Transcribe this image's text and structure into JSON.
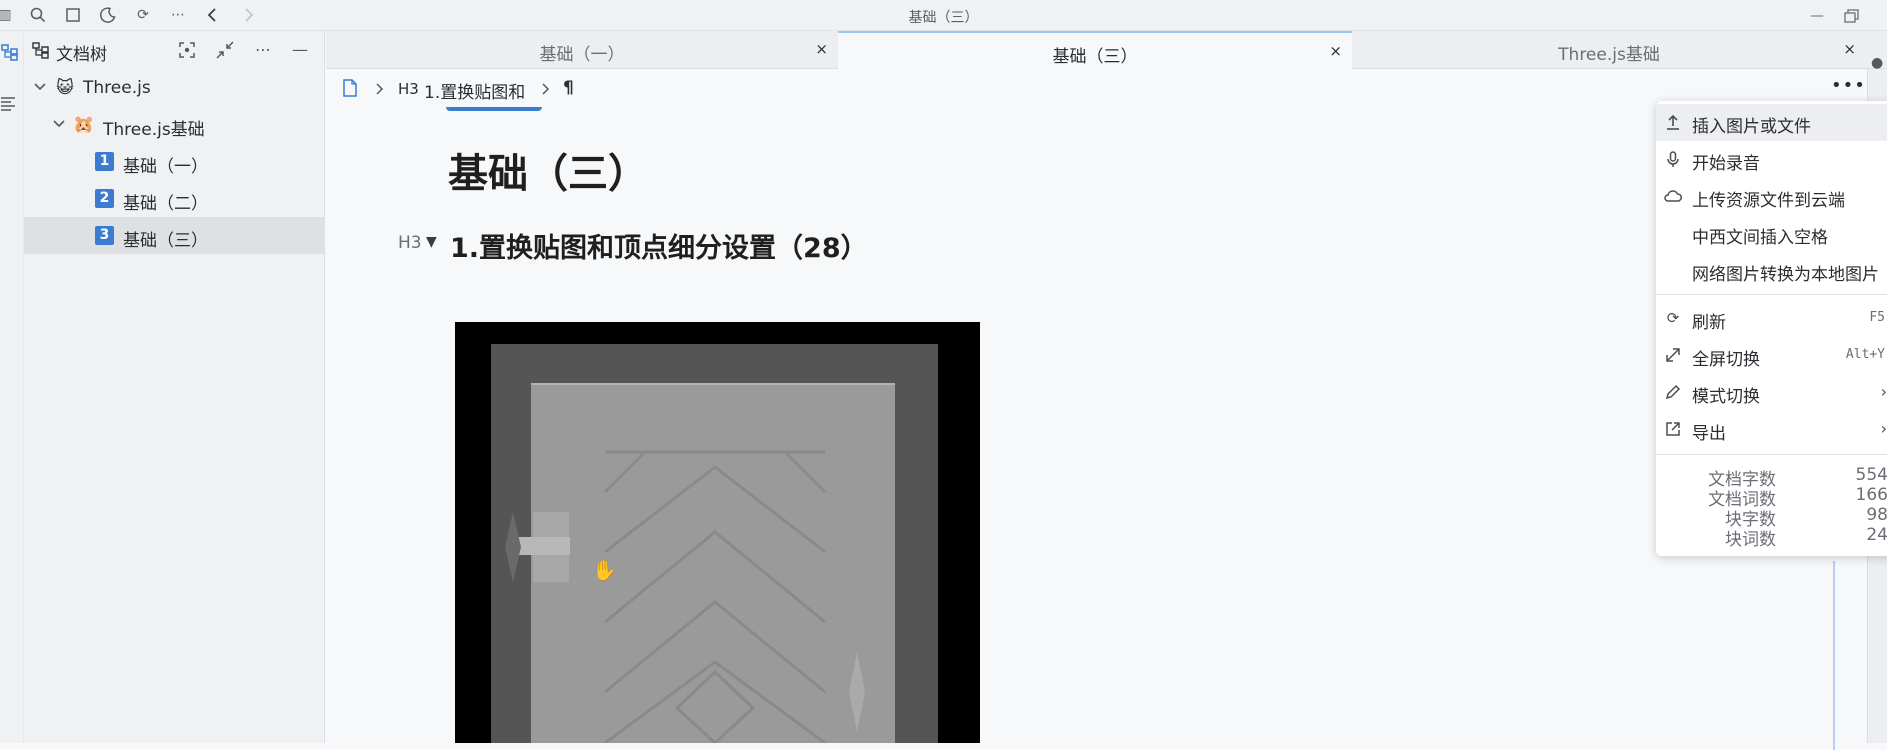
{
  "window": {
    "title": "基础（三）"
  },
  "titlebar_icons": [
    "panel-icon",
    "search-icon",
    "square-icon",
    "moon-icon",
    "sync-icon",
    "more-icon",
    "back-icon",
    "forward-icon"
  ],
  "sidebar": {
    "title": "文档树",
    "tree": [
      {
        "label": "Three.js",
        "emoji": "😺",
        "level": 0,
        "expanded": true
      },
      {
        "label": "Three.js基础",
        "emoji": "🐹",
        "level": 1,
        "expanded": true
      },
      {
        "label": "基础（一）",
        "num": "1",
        "level": 2
      },
      {
        "label": "基础（二）",
        "num": "2",
        "level": 2
      },
      {
        "label": "基础（三）",
        "num": "3",
        "level": 2,
        "selected": true
      }
    ]
  },
  "tabs": [
    {
      "label": "基础（一）",
      "active": false
    },
    {
      "label": "基础（三）",
      "active": true
    },
    {
      "label": "Three.js基础",
      "active": false
    }
  ],
  "tab_close": "×",
  "breadcrumb": {
    "heading_tag": "H3",
    "heading": "1.置换贴图和",
    "pilcrow": "¶"
  },
  "document": {
    "title": "基础（三）",
    "heading_tag": "H3",
    "heading": "1.置换贴图和顶点细分设置（28）"
  },
  "menu": {
    "items": [
      {
        "label": "插入图片或文件",
        "icon": "upload-icon",
        "hover": true
      },
      {
        "label": "开始录音",
        "icon": "mic-icon"
      },
      {
        "label": "上传资源文件到云端",
        "icon": "cloud-icon"
      },
      {
        "label": "中西文间插入空格",
        "icon": ""
      },
      {
        "label": "网络图片转换为本地图片",
        "icon": ""
      }
    ],
    "items2": [
      {
        "label": "刷新",
        "icon": "refresh-icon",
        "key": "F5"
      },
      {
        "label": "全屏切换",
        "icon": "fullscreen-icon",
        "key": "Alt+Y"
      },
      {
        "label": "模式切换",
        "icon": "pencil-icon",
        "submenu": true
      },
      {
        "label": "导出",
        "icon": "export-icon",
        "submenu": true
      }
    ],
    "stats": [
      {
        "label": "文档字数",
        "value": "554"
      },
      {
        "label": "文档词数",
        "value": "166"
      },
      {
        "label": "块字数",
        "value": "98"
      },
      {
        "label": "块词数",
        "value": "24"
      }
    ]
  },
  "colors": {
    "accent": "#3b7bd0",
    "selected_row": "#dfe0e3",
    "background": "#f6f8fa"
  }
}
